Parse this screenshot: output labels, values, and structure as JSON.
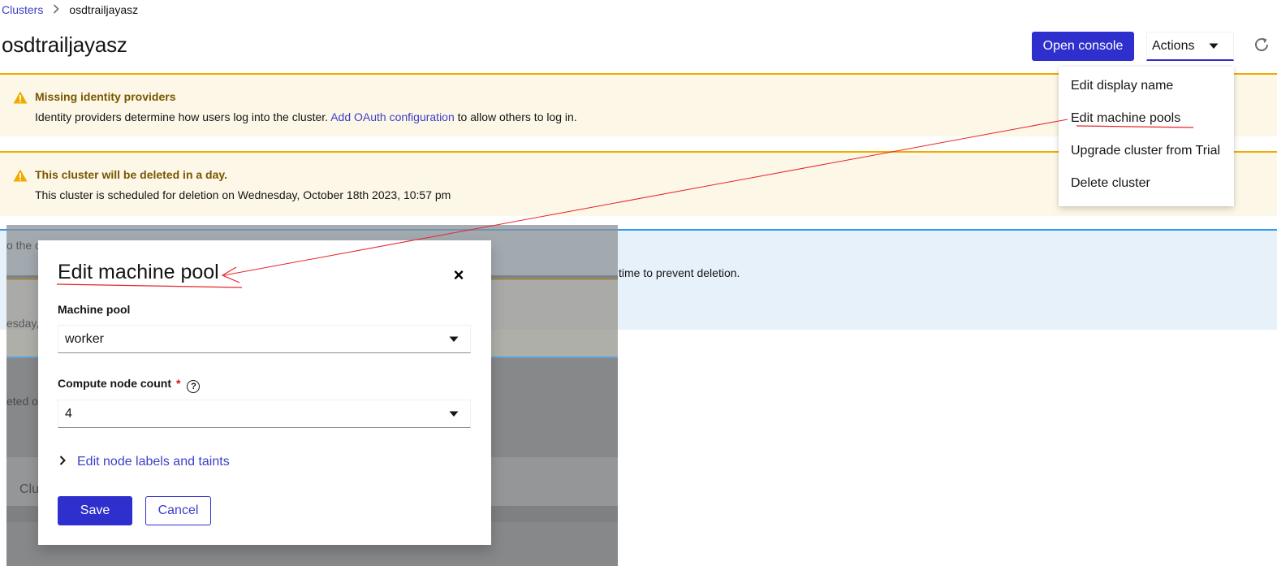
{
  "breadcrumb": {
    "parent": "Clusters",
    "current": "osdtrailjayasz"
  },
  "header": {
    "title": "osdtrailjayasz",
    "open_console_label": "Open console",
    "actions_label": "Actions"
  },
  "alerts": [
    {
      "title": "Missing identity providers",
      "body_prefix": "Identity providers determine how users log into the cluster. ",
      "link": "Add OAuth configuration",
      "body_suffix": " to allow others to log in."
    },
    {
      "title": "This cluster will be deleted in a day.",
      "body": "This cluster is scheduled for deletion on Wednesday, October 18th 2023, 10:57 pm"
    }
  ],
  "background_fragments": {
    "info_start": "o the c",
    "info_end": "time to prevent deletion.",
    "weekday": "esday,",
    "deleted": "eted or",
    "tab": "Clu"
  },
  "actions_menu": {
    "items": [
      "Edit display name",
      "Edit machine pools",
      "Upgrade cluster from Trial",
      "Delete cluster"
    ]
  },
  "modal": {
    "title": "Edit machine pool",
    "close_symbol": "×",
    "machine_pool_label": "Machine pool",
    "machine_pool_value": "worker",
    "node_count_label": "Compute node count",
    "required_mark": "*",
    "help_symbol": "?",
    "node_count_value": "4",
    "expand_label": "Edit node labels and taints",
    "save_label": "Save",
    "cancel_label": "Cancel"
  },
  "colors": {
    "primary": "#2e2fcc",
    "link": "#3c3fc8",
    "warning_bg": "#fdf7e7",
    "warning_border": "#f0ab00",
    "info_bg": "#e7f1fa",
    "annotation": "#e8232a"
  },
  "icons": {
    "breadcrumb_separator": "chevron-right-icon",
    "actions_caret": "caret-down-icon",
    "refresh": "redo-icon",
    "alert": "exclamation-triangle-icon",
    "expand": "chevron-right-icon"
  }
}
